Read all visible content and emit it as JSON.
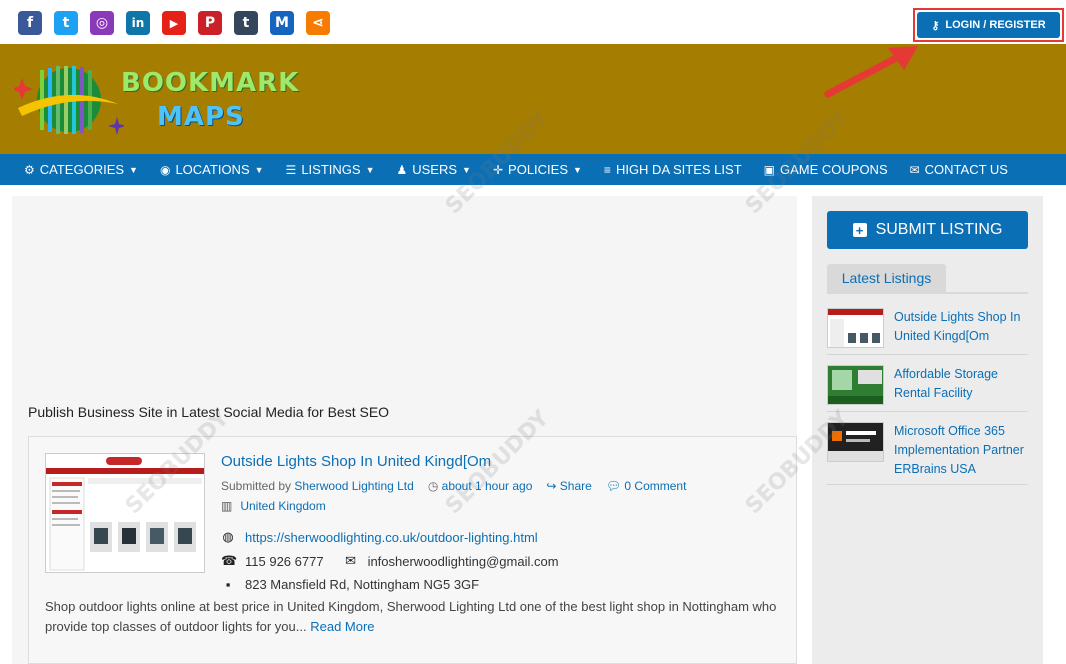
{
  "social": [
    {
      "icon": "facebook-icon",
      "glyph": "f",
      "color": "#3b5998"
    },
    {
      "icon": "twitter-icon",
      "glyph": "t",
      "color": "#1da1f2"
    },
    {
      "icon": "instagram-icon",
      "glyph": "◎",
      "color": "#8a3ab9"
    },
    {
      "icon": "linkedin-icon",
      "glyph": "in",
      "color": "#0e76a8"
    },
    {
      "icon": "youtube-icon",
      "glyph": "▶",
      "color": "#e62117"
    },
    {
      "icon": "pinterest-icon",
      "glyph": "P",
      "color": "#cb2027"
    },
    {
      "icon": "tumblr-icon",
      "glyph": "t",
      "color": "#35465c"
    },
    {
      "icon": "medium-icon",
      "glyph": "M",
      "color": "#1565c0"
    },
    {
      "icon": "share-icon",
      "glyph": "⋖",
      "color": "#f57c00"
    }
  ],
  "header": {
    "login_label": "LOGIN / REGISTER",
    "logo_line1": "BOOKMARK",
    "logo_line2": "MAPS"
  },
  "nav": [
    {
      "label": "CATEGORIES",
      "icon": "gears-icon",
      "glyph": "⚙",
      "caret": true
    },
    {
      "label": "LOCATIONS",
      "icon": "globe-icon",
      "glyph": "◉",
      "caret": true
    },
    {
      "label": "LISTINGS",
      "icon": "list-icon",
      "glyph": "☰",
      "caret": true
    },
    {
      "label": "USERS",
      "icon": "user-icon",
      "glyph": "♟",
      "caret": true
    },
    {
      "label": "POLICIES",
      "icon": "crosshair-icon",
      "glyph": "✛",
      "caret": true
    },
    {
      "label": "HIGH DA SITES LIST",
      "icon": "text-icon",
      "glyph": "≡",
      "caret": false
    },
    {
      "label": "GAME COUPONS",
      "icon": "coupon-icon",
      "glyph": "▣",
      "caret": false
    },
    {
      "label": "CONTACT US",
      "icon": "envelope-icon",
      "glyph": "✉",
      "caret": false
    }
  ],
  "main": {
    "section_title": "Publish Business Site in Latest Social Media for Best SEO",
    "listing": {
      "title": "Outside Lights Shop In United Kingd[Om",
      "submitted_prefix": "Submitted by",
      "author": "Sherwood Lighting Ltd",
      "time": "about 1 hour ago",
      "share": "Share",
      "comments": "0 Comment",
      "location": "United Kingdom",
      "website": "https://sherwoodlighting.co.uk/outdoor-lighting.html",
      "phone": "115 926 6777",
      "email": "infosherwoodlighting@gmail.com",
      "address": "823 Mansfield Rd, Nottingham NG5 3GF",
      "description": "Shop outdoor lights online at best price in United Kingdom, Sherwood Lighting Ltd one of the best light shop in Nottingham who provide top classes of outdoor lights for you...",
      "read_more": "Read More"
    }
  },
  "sidebar": {
    "submit_label": "SUBMIT LISTING",
    "latest_title": "Latest Listings",
    "latest": [
      {
        "title": "Outside Lights Shop In United Kingd[Om"
      },
      {
        "title": "Affordable Storage Rental Facility"
      },
      {
        "title": "Microsoft Office 365 Implementation Partner ERBrains USA"
      }
    ]
  },
  "watermark": "SEOBUDDY"
}
